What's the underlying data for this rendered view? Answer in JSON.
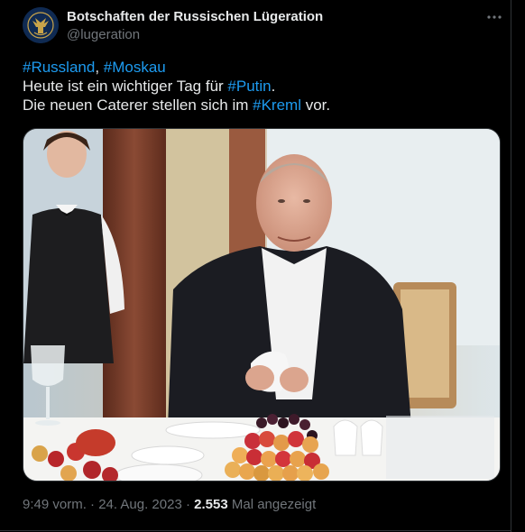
{
  "author": {
    "display_name": "Botschaften der Russischen Lügeration",
    "handle": "@lugeration",
    "avatar_icon": "embassy-emblem-icon"
  },
  "tweet": {
    "hashtag_1": "#Russland",
    "separator": ", ",
    "hashtag_2": "#Moskau",
    "line2_prefix": "Heute ist ein wichtiger Tag für ",
    "hashtag_3": "#Putin",
    "line2_suffix": ".",
    "line3_prefix": "Die neuen Caterer stellen sich im ",
    "hashtag_4": "#Kreml",
    "line3_suffix": " vor."
  },
  "media": {
    "description_icon": "photo-image"
  },
  "meta": {
    "time": "9:49 vorm.",
    "dot": " · ",
    "date": "24. Aug. 2023",
    "views_count": "2.553",
    "views_label": " Mal angezeigt"
  },
  "colors": {
    "background": "#000000",
    "text": "#e7e9ea",
    "secondary": "#71767b",
    "link": "#1d9bf0",
    "border": "#2f3336"
  }
}
